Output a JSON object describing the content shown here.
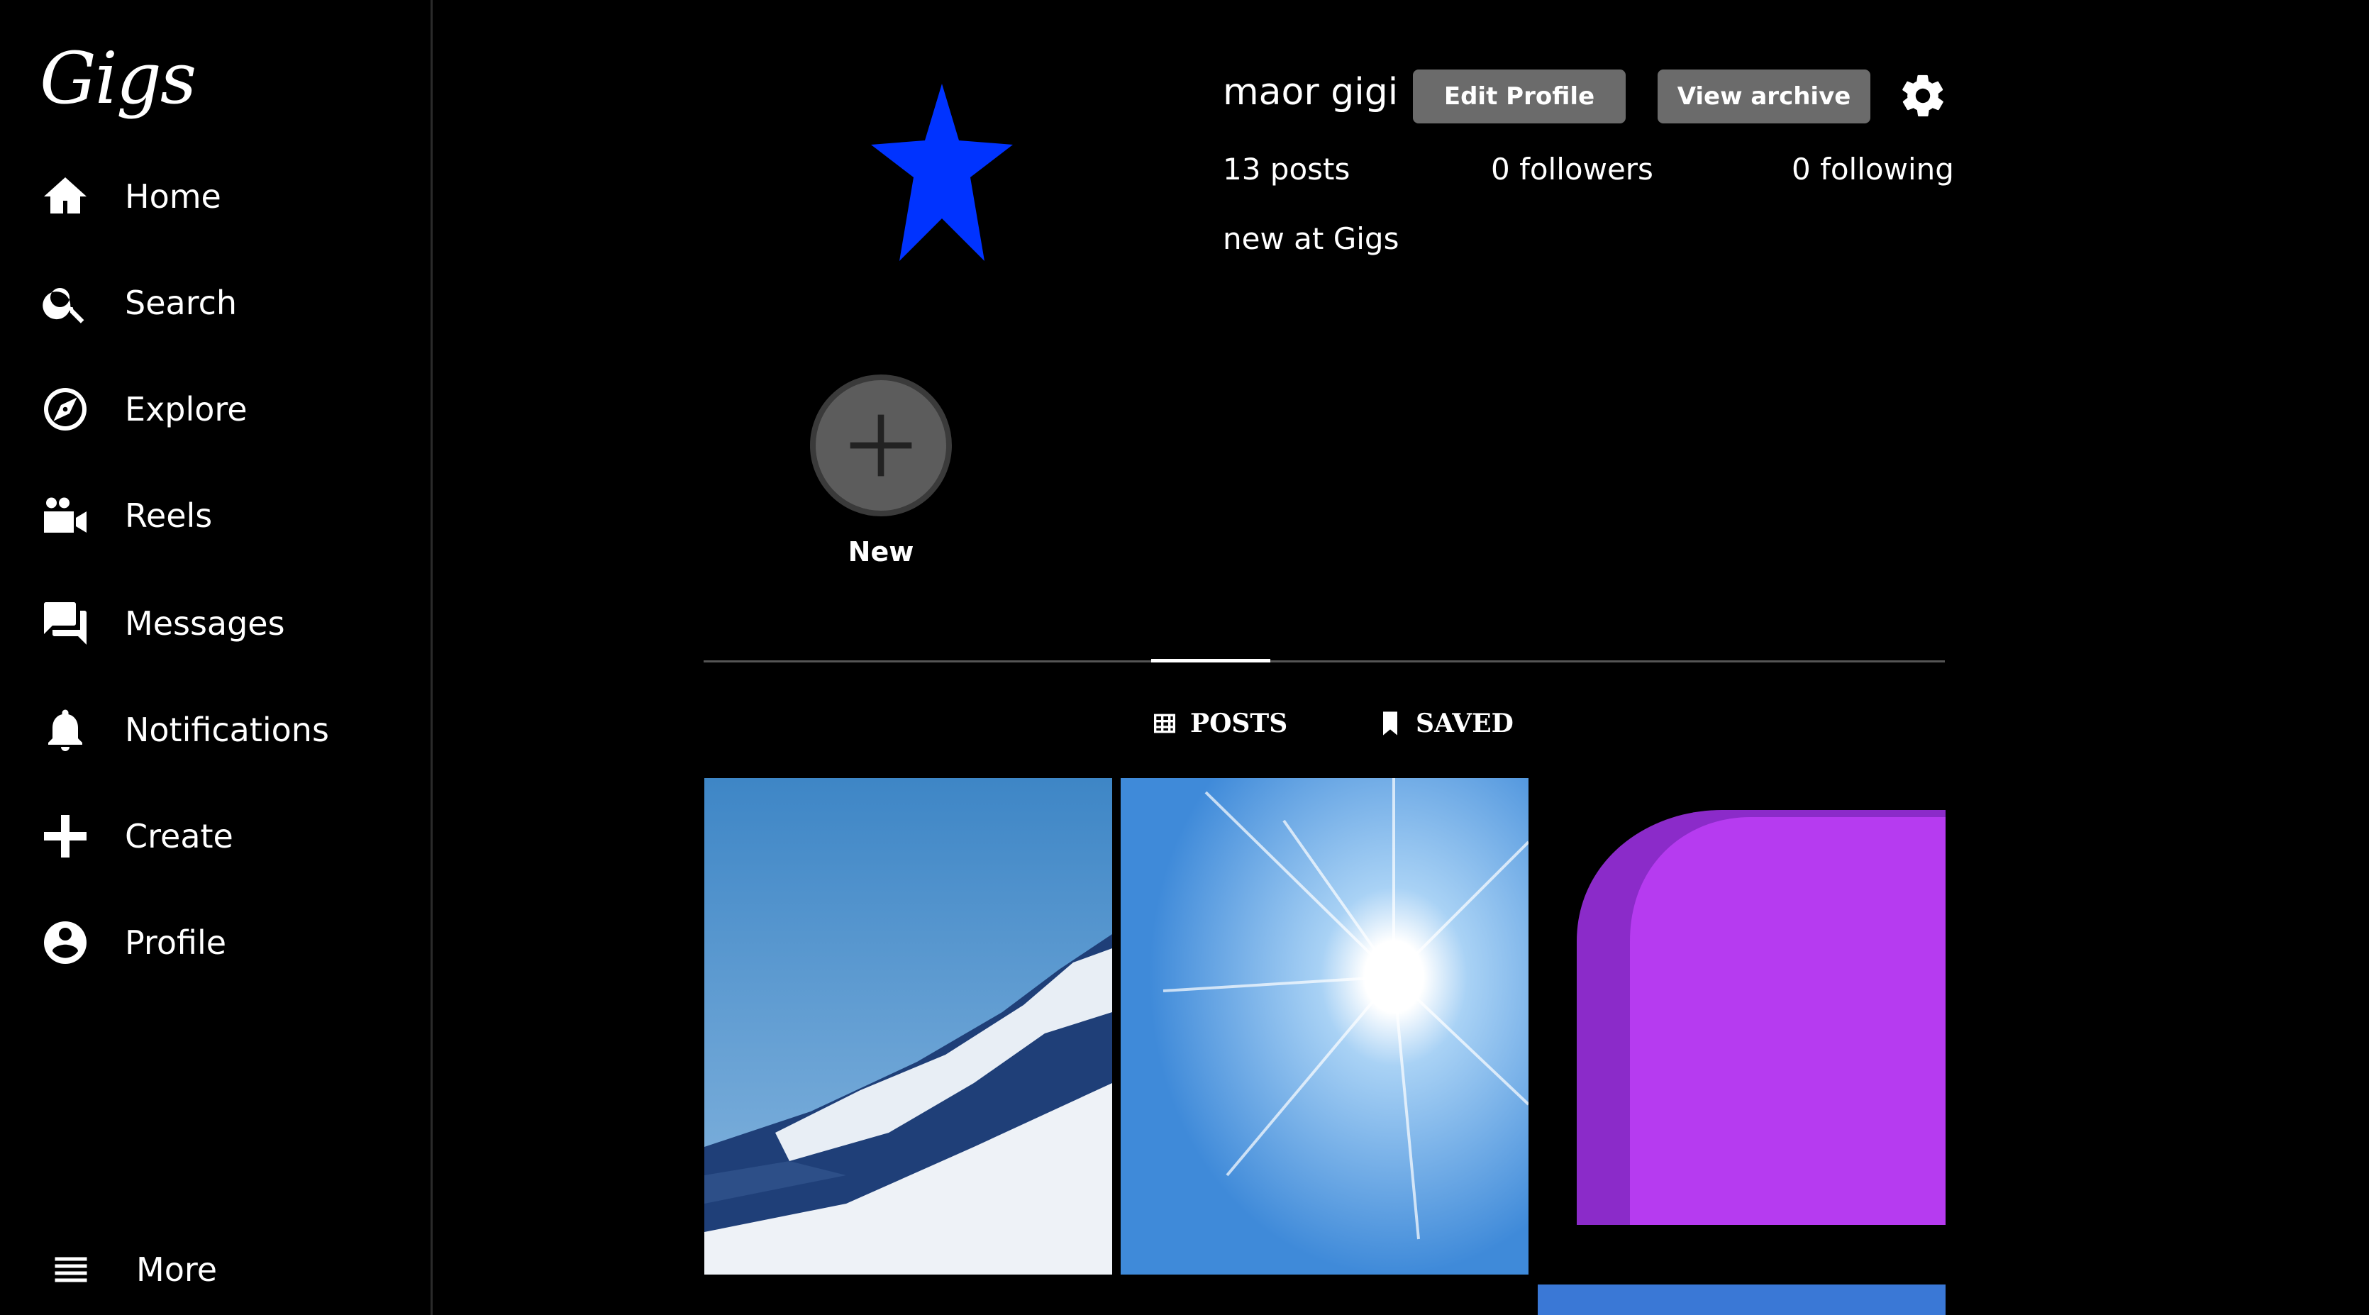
{
  "app": {
    "logo": "Gigs"
  },
  "sidebar": {
    "items": [
      {
        "label": "Home",
        "icon": "home-icon"
      },
      {
        "label": "Search",
        "icon": "search-icon"
      },
      {
        "label": "Explore",
        "icon": "compass-icon"
      },
      {
        "label": "Reels",
        "icon": "video-camera-icon"
      },
      {
        "label": "Messages",
        "icon": "chat-icon"
      },
      {
        "label": "Notifications",
        "icon": "bell-icon"
      },
      {
        "label": "Create",
        "icon": "plus-icon"
      },
      {
        "label": "Profile",
        "icon": "account-circle-icon"
      }
    ],
    "more_label": "More"
  },
  "profile": {
    "username": "maor gigi",
    "edit_label": "Edit Profile",
    "archive_label": "View archive",
    "posts": "13 posts",
    "followers": "0 followers",
    "following": "0 following",
    "bio": "new at Gigs",
    "avatar_color": "#0033ff"
  },
  "highlights": {
    "new_label": "New"
  },
  "tabs": {
    "posts_label": "POSTS",
    "saved_label": "SAVED",
    "active": "POSTS"
  }
}
